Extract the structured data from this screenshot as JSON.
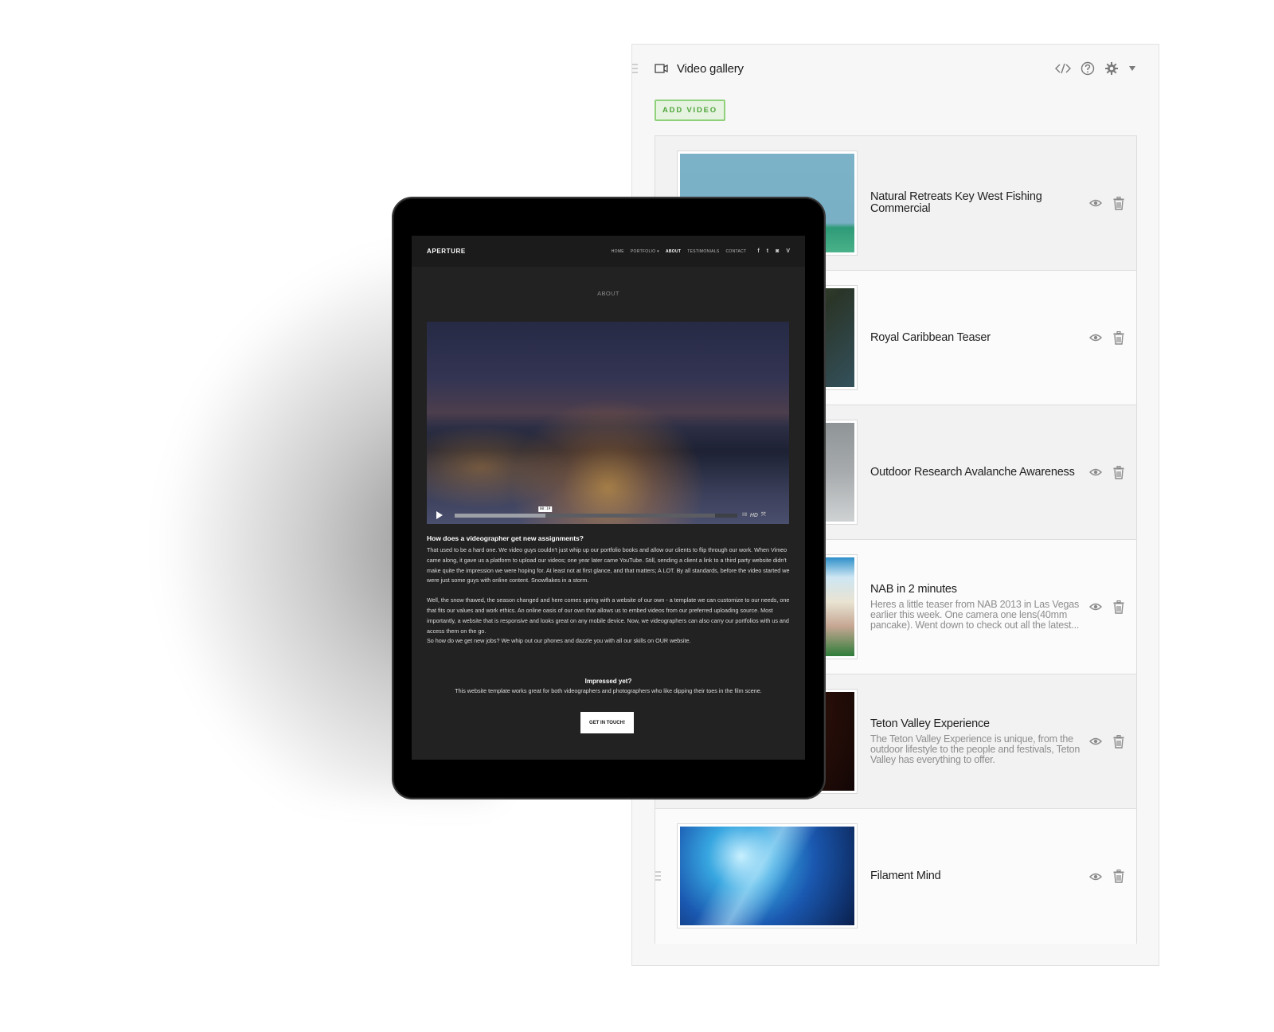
{
  "panel": {
    "title": "Video gallery",
    "icons": {
      "module": "video-camera-icon",
      "embed": "code-icon",
      "help": "help-icon",
      "settings": "gear-icon",
      "collapse": "caret-down-icon"
    },
    "add_button_label": "ADD VIDEO",
    "videos": [
      {
        "title": "Natural Retreats Key West Fishing Commercial",
        "description": "",
        "thumbnail": "fishing boat on turquoise water"
      },
      {
        "title": "Royal Caribbean Teaser",
        "description": "",
        "thumbnail": "aerial coastline"
      },
      {
        "title": "Outdoor Research Avalanche Awareness",
        "description": "",
        "thumbnail": "snowy mountain slope"
      },
      {
        "title": "NAB in 2 minutes",
        "description": "Heres a little teaser from NAB 2013 in Las Vegas earlier this week. One camera one lens(40mm pancake). Went down to check out all the latest...",
        "thumbnail": "woman seated at trade show booth"
      },
      {
        "title": "Teton Valley Experience",
        "description": "The Teton Valley Experience is unique, from the outdoor lifestyle to the people and festivals, Teton Valley has everything to offer.",
        "thumbnail": "concert stage lights"
      },
      {
        "title": "Filament Mind",
        "description": "",
        "thumbnail": "blue glowing filament installation"
      }
    ],
    "row_actions": {
      "preview": "eye-icon",
      "delete": "trash-icon"
    }
  },
  "tablet_site": {
    "brand": "APERTURE",
    "nav": [
      {
        "label": "HOME",
        "active": false
      },
      {
        "label": "PORTFOLIO ▾",
        "active": false
      },
      {
        "label": "ABOUT",
        "active": true
      },
      {
        "label": "TESTIMONIALS",
        "active": false
      },
      {
        "label": "CONTACT",
        "active": false
      }
    ],
    "social": {
      "facebook": "f",
      "twitter": "t",
      "instagram": "◙",
      "vimeo": "V"
    },
    "page_title": "ABOUT",
    "video": {
      "current_time": "00:19",
      "played_fraction": 0.32,
      "loaded_fraction": 0.92,
      "hd_label": "HD",
      "volume_label": "IIIII",
      "fullscreen_label": "⤧"
    },
    "article": {
      "heading": "How does a videographer get new assignments?",
      "paragraph1": "That used to be a hard one. We video guys couldn't just whip up our portfolio books and allow our clients to flip through our work. When Vimeo came along, it gave us a platform to upload our videos; one year later came YouTube. Still, sending a client a link to a third party website didn't make quite the impression we were hoping for. At least not at first glance, and that matters; A LOT. By all standards, before the video started we were just some guys with online content. Snowflakes in a storm.",
      "paragraph2": "Well, the snow thawed, the season changed and here comes spring with a website of our own - a template we can customize to our needs, one that fits our values and work ethics. An online oasis of our own that allows us to embed videos from our preferred uploading source. Most importantly, a website that is responsive and looks great on any mobile device. Now, we videographers can also carry our portfolios with us and access them on the go.",
      "paragraph3": "So how do we get new jobs? We whip out our phones and dazzle you with all our skills on OUR website."
    },
    "impressed": {
      "heading": "Impressed yet?",
      "text": "This website template works great for both videographers and photographers who like dipping their toes in the film scene."
    },
    "cta_label": "GET IN TOUCH!"
  }
}
